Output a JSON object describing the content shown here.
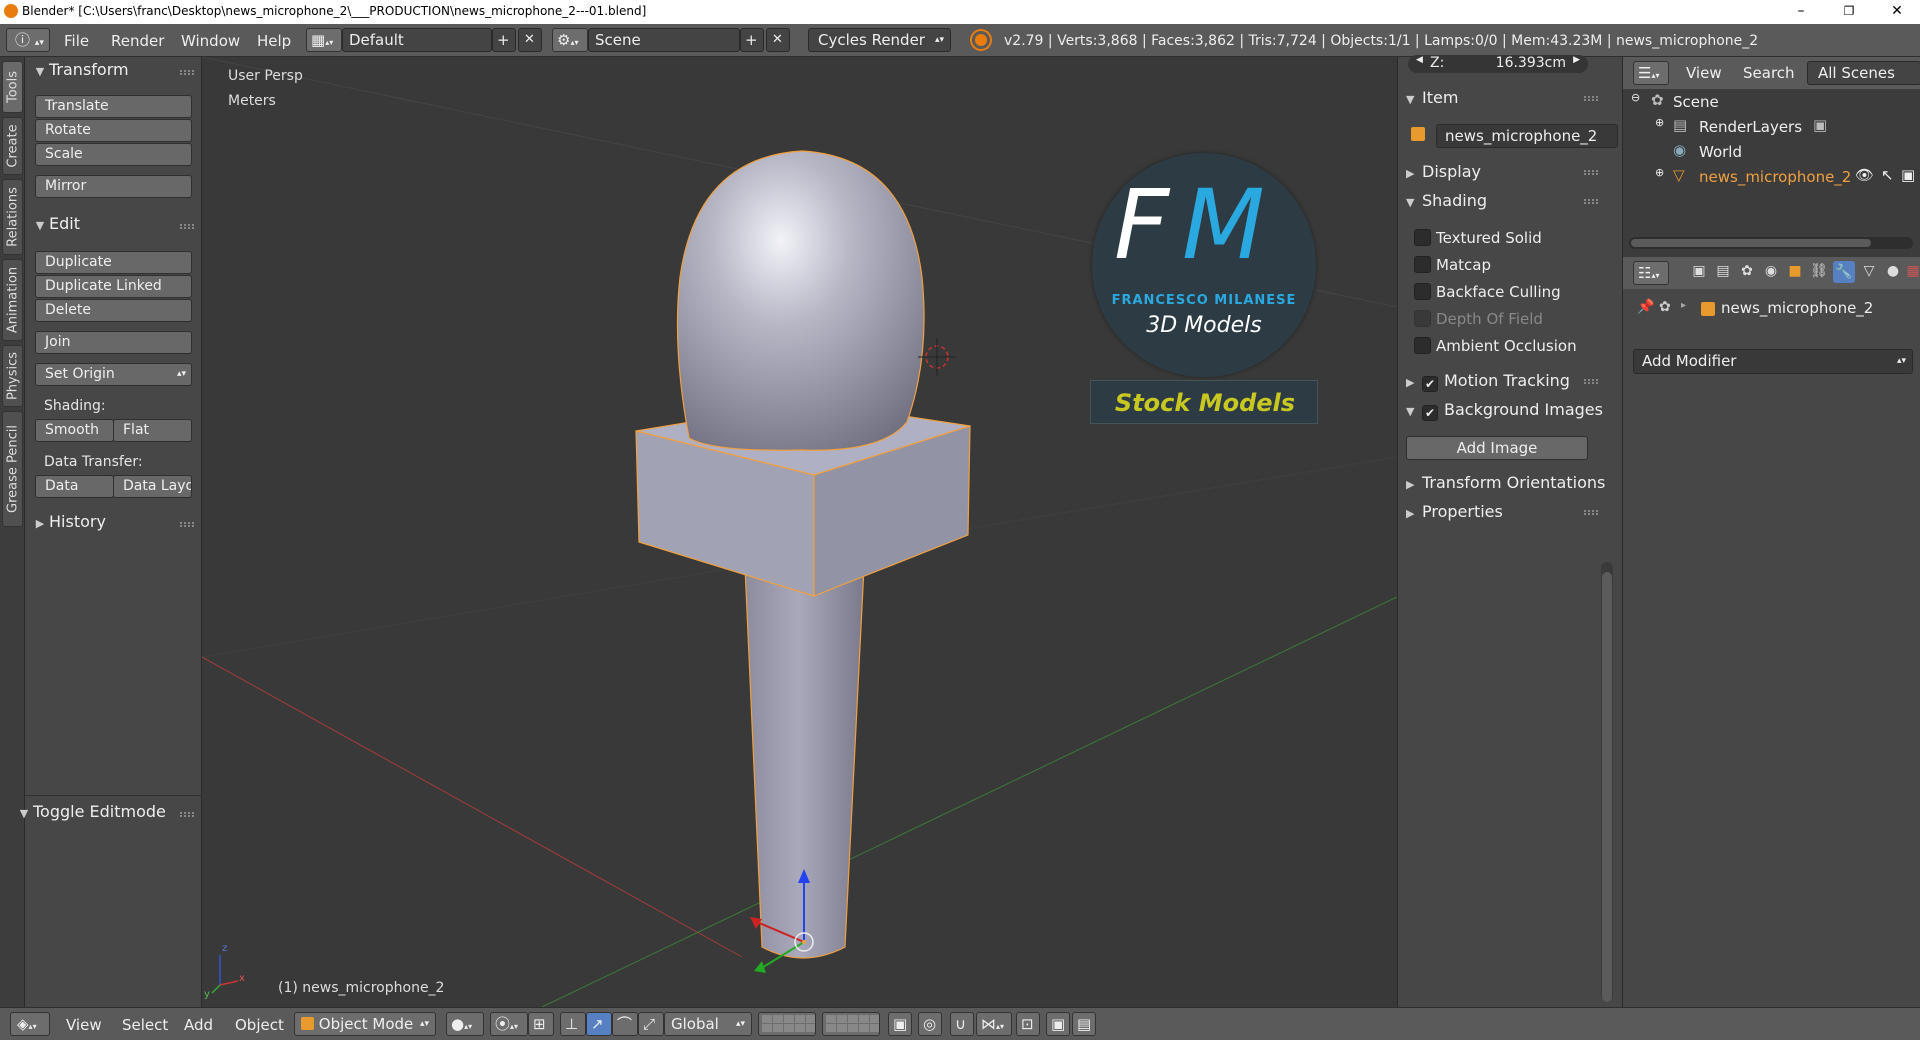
{
  "window": {
    "title": "Blender* [C:\\Users\\franc\\Desktop\\news_microphone_2\\___PRODUCTION\\news_microphone_2---01.blend]",
    "minimize": "–",
    "maximize": "❐",
    "close": "✕"
  },
  "menubar": {
    "info_icon": "ⓘ",
    "file": "File",
    "render": "Render",
    "window": "Window",
    "help": "Help",
    "layout_name": "Default",
    "scene_name": "Scene",
    "render_engine": "Cycles Render",
    "stats": "v2.79 | Verts:3,868 | Faces:3,862 | Tris:7,724 | Objects:1/1 | Lamps:0/0 | Mem:43.23M | news_microphone_2",
    "add_symbol": "+",
    "remove_symbol": "✕"
  },
  "tool_tabs": [
    "Tools",
    "Create",
    "Relations",
    "Animation",
    "Physics",
    "Grease Pencil"
  ],
  "toolshelf": {
    "transform_header": "Transform",
    "translate": "Translate",
    "rotate": "Rotate",
    "scale": "Scale",
    "mirror": "Mirror",
    "edit_header": "Edit",
    "duplicate": "Duplicate",
    "duplicate_linked": "Duplicate Linked",
    "delete": "Delete",
    "join": "Join",
    "set_origin": "Set Origin",
    "shading_label": "Shading:",
    "smooth": "Smooth",
    "flat": "Flat",
    "data_transfer_label": "Data Transfer:",
    "data": "Data",
    "data_layout": "Data Layo",
    "history_header": "History",
    "toggle_editmode_header": "Toggle Editmode"
  },
  "viewport": {
    "view_name": "User Persp",
    "units": "Meters",
    "object_label": "(1) news_microphone_2",
    "logo": {
      "initial_f": "F",
      "initial_m": "M",
      "name": "FRANCESCO MILANESE",
      "tagline": "3D Models",
      "banner": "Stock Models"
    },
    "axis_x": "x",
    "axis_y": "y",
    "axis_z": "z"
  },
  "npanel": {
    "z_label": "Z:",
    "z_value": "16.393cm",
    "item_header": "Item",
    "object_name": "news_microphone_2",
    "display_header": "Display",
    "shading_header": "Shading",
    "textured_solid": "Textured Solid",
    "matcap": "Matcap",
    "backface_culling": "Backface Culling",
    "depth_of_field": "Depth Of Field",
    "ambient_occlusion": "Ambient Occlusion",
    "motion_tracking": "Motion Tracking",
    "background_images": "Background Images",
    "add_image": "Add Image",
    "transform_orientations": "Transform Orientations",
    "properties": "Properties"
  },
  "outliner": {
    "view": "View",
    "search": "Search",
    "all_scenes": "All Scenes",
    "scene": "Scene",
    "render_layers": "RenderLayers",
    "world": "World",
    "object": "news_microphone_2"
  },
  "properties_editor": {
    "object_name": "news_microphone_2",
    "add_modifier": "Add Modifier"
  },
  "bottombar": {
    "view": "View",
    "select": "Select",
    "add": "Add",
    "object": "Object",
    "mode": "Object Mode",
    "orientation": "Global"
  },
  "colors": {
    "accent_blue": "#5680c2",
    "selection_orange": "#f0a040",
    "logo_blue": "#29a9e0",
    "logo_yellow": "#c8c820",
    "axis_red": "#c0392b",
    "axis_green": "#3a8a3a"
  }
}
